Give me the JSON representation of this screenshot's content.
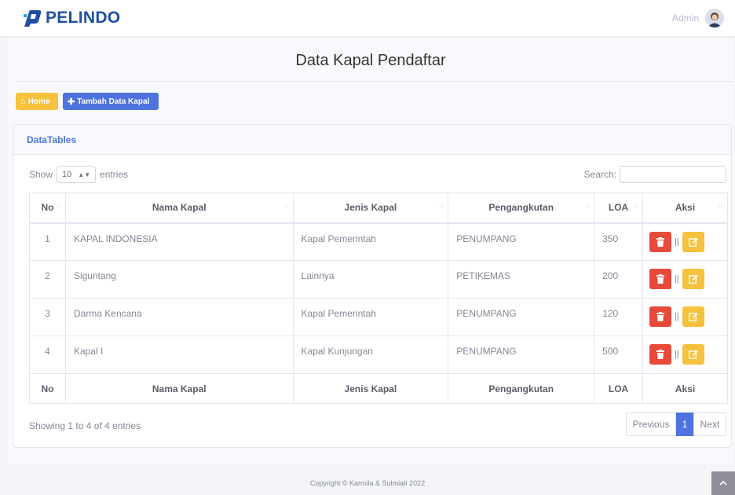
{
  "brand": {
    "name": "PELINDO",
    "logo_icon": "pelindo-logo-icon",
    "color": "#1f4fa3"
  },
  "user": {
    "name": "Admin",
    "avatar_icon": "user-avatar-icon"
  },
  "page": {
    "title": "Data Kapal Pendaftar"
  },
  "actions": {
    "home_label": "Home",
    "home_icon": "home-icon",
    "add_label": "Tambah Data Kapal",
    "add_icon": "plus-icon"
  },
  "card": {
    "title": "DataTables"
  },
  "table_controls": {
    "show_label": "Show",
    "entries_value": "10",
    "entries_label": "entries",
    "search_label": "Search:",
    "search_value": ""
  },
  "table": {
    "columns": [
      "No",
      "Nama Kapal",
      "Jenis Kapal",
      "Pengangkutan",
      "LOA",
      "Aksi"
    ],
    "rows": [
      {
        "no": "1",
        "nama": "KAPAL INDONESIA",
        "jenis": "Kapal Pemerintah",
        "angkut": "PENUMPANG",
        "loa": "350"
      },
      {
        "no": "2",
        "nama": "Siguntang",
        "jenis": "Lainnya",
        "angkut": "PETIKEMAS",
        "loa": "200"
      },
      {
        "no": "3",
        "nama": "Darma Kencana",
        "jenis": "Kapal Pemerintah",
        "angkut": "PENUMPANG",
        "loa": "120"
      },
      {
        "no": "4",
        "nama": "Kapal I",
        "jenis": "Kapal Kunjungan",
        "angkut": "PENUMPANG",
        "loa": "500"
      }
    ],
    "separator": "||"
  },
  "pagination": {
    "info": "Showing 1 to 4 of 4 entries",
    "previous": "Previous",
    "current": "1",
    "next": "Next"
  },
  "footer": {
    "text": "Copyright © Karmila & Sulmiati 2022"
  },
  "colors": {
    "primary": "#4e73df",
    "warning": "#f6c23e",
    "danger": "#e74a3b"
  }
}
